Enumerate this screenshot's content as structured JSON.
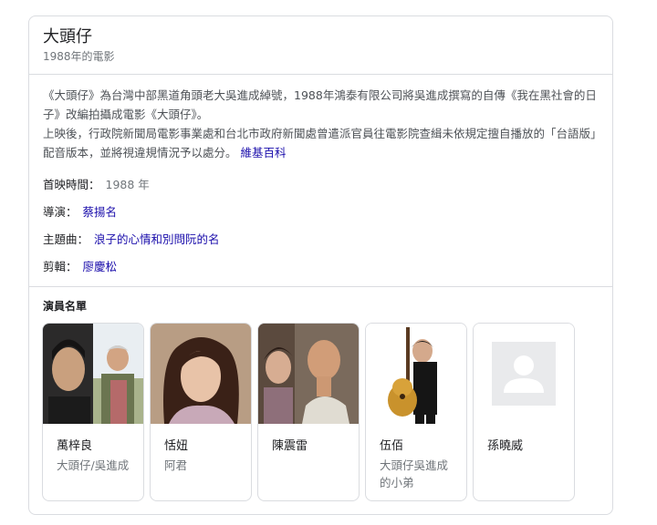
{
  "entity": {
    "title": "大頭仔",
    "subtitle": "1988年的電影"
  },
  "description": {
    "text1": "《大頭仔》為台灣中部黑道角頭老大吳進成綽號，1988年鴻泰有限公司將吳進成撰寫的自傳《我在黑社會的日子》改編拍攝成電影《大頭仔》。",
    "text2": "上映後，行政院新聞局電影事業處和台北市政府新聞處曾遣派官員往電影院查緝未依規定擅自播放的「台語版」配音版本，並將視違規情況予以處分。",
    "source_link": "維基百科"
  },
  "facts": [
    {
      "key": "首映時間：",
      "value": "1988 年"
    },
    {
      "key": "導演：",
      "value": "蔡揚名"
    },
    {
      "key": "主題曲：",
      "value": "浪子的心情和別問阮的名"
    },
    {
      "key": "剪輯：",
      "value": "廖慶松"
    }
  ],
  "cast_section": {
    "title": "演員名單",
    "members": [
      {
        "name": "萬梓良",
        "role": "大頭仔/吳進成",
        "photo": "portrait-photo"
      },
      {
        "name": "恬妞",
        "role": "阿君",
        "photo": "portrait-photo"
      },
      {
        "name": "陳震雷",
        "role": "",
        "photo": "portrait-photo"
      },
      {
        "name": "伍佰",
        "role": "大頭仔吳進成的小弟",
        "photo": "portrait-photo"
      },
      {
        "name": "孫曉威",
        "role": "",
        "photo": "placeholder-person-icon"
      }
    ]
  },
  "colors": {
    "link": "#1a0dab",
    "muted_text": "#70757a",
    "border": "#dadce0"
  }
}
